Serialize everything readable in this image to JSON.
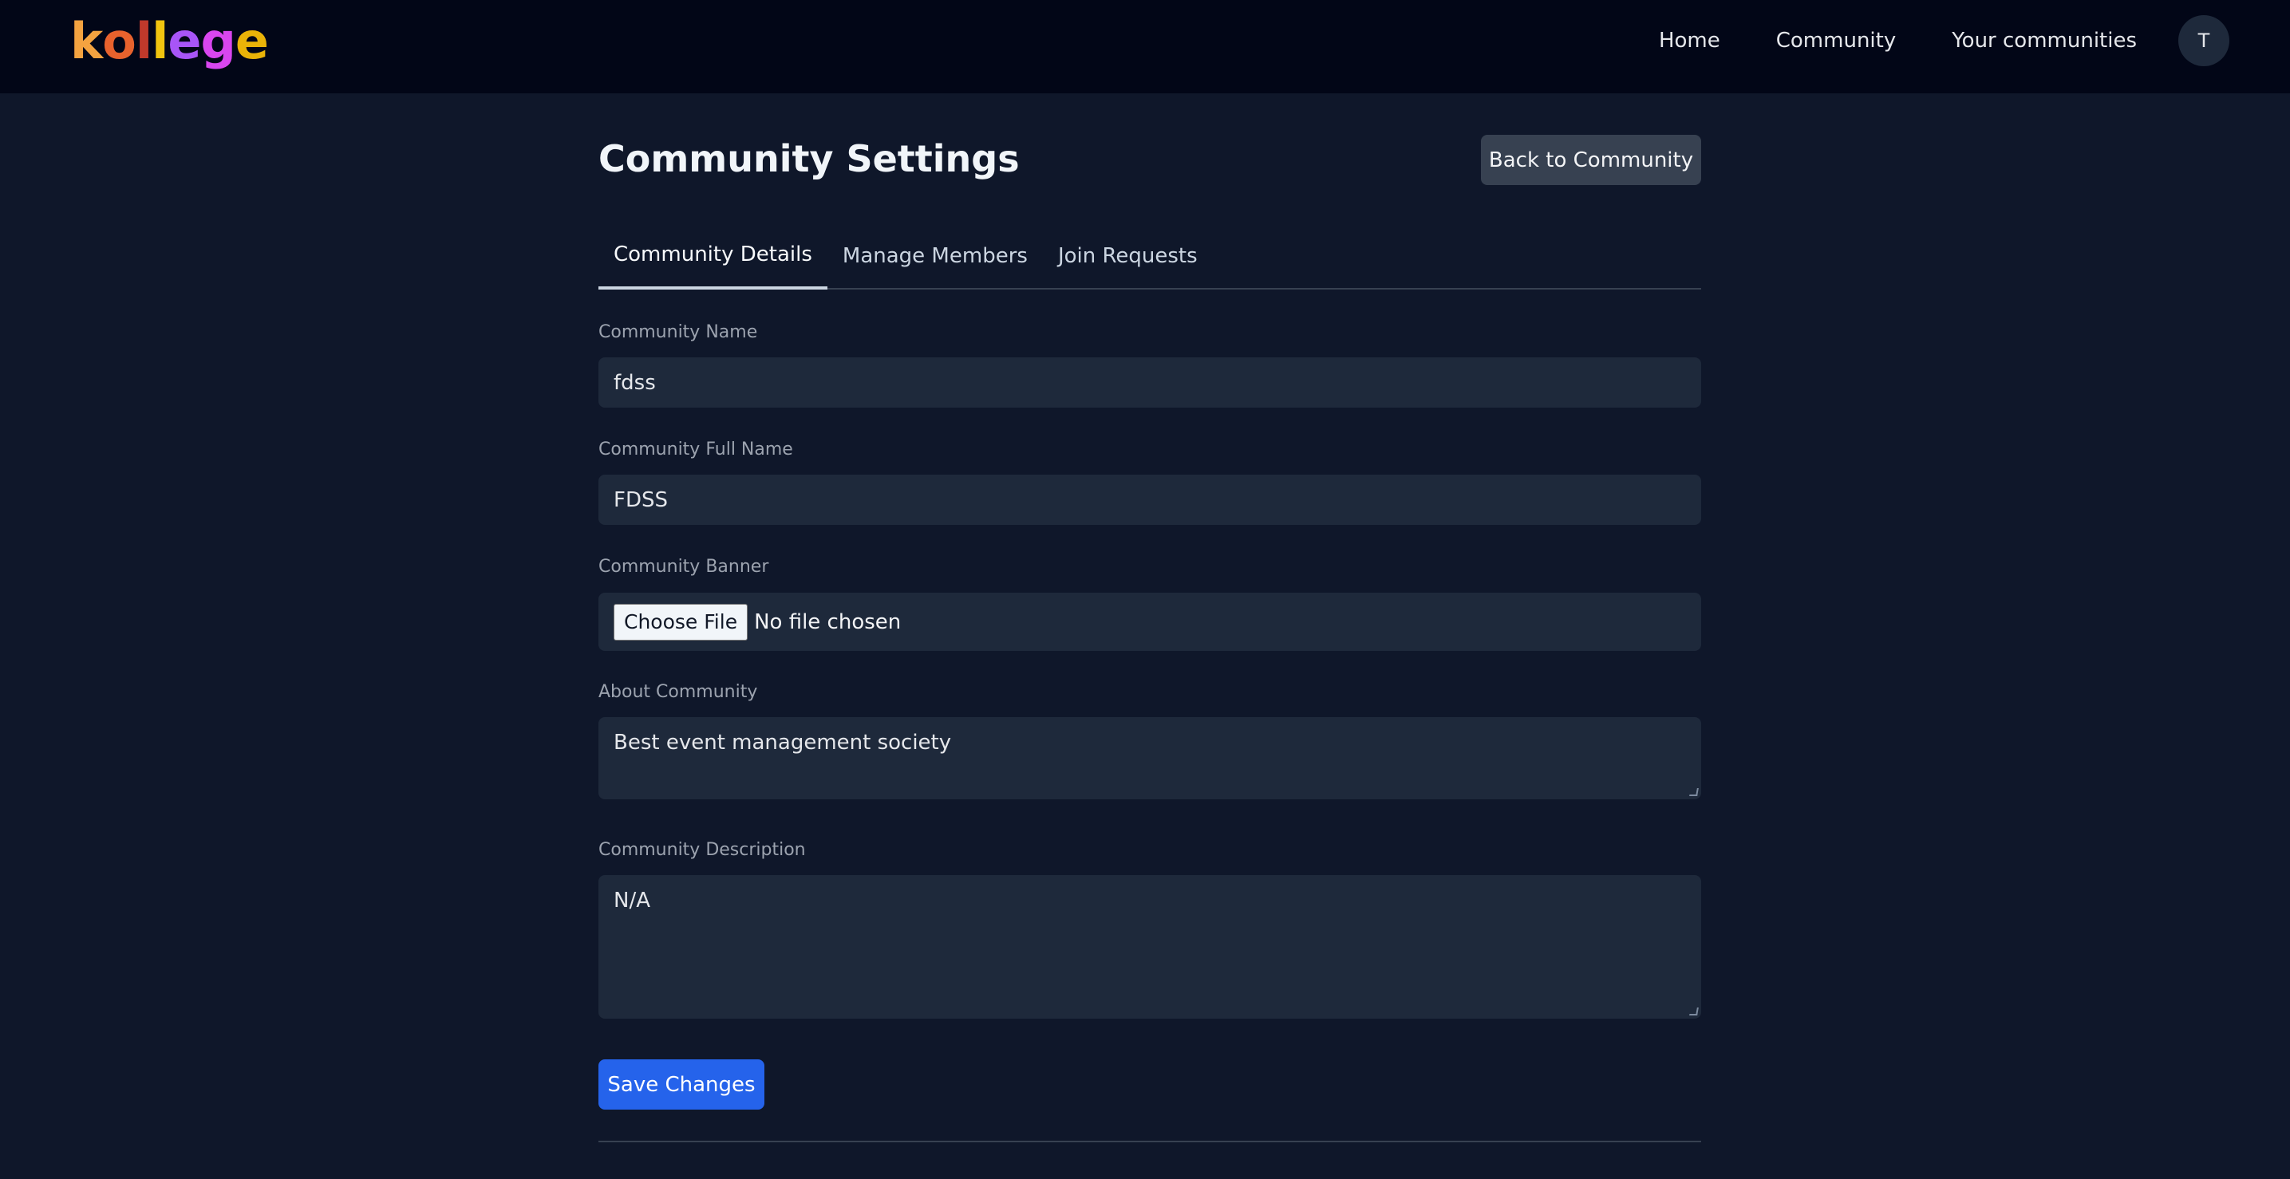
{
  "app": {
    "logo_letters": [
      {
        "char": "k",
        "color": "#f4a340"
      },
      {
        "char": "o",
        "color": "#e8622d"
      },
      {
        "char": "l",
        "color": "#c0392b"
      },
      {
        "char": "l",
        "color": "#f1c40f"
      },
      {
        "char": "e",
        "color": "#a855f7"
      },
      {
        "char": "g",
        "color": "#d946ef"
      },
      {
        "char": "e",
        "color": "#eab308"
      }
    ]
  },
  "nav": {
    "home": "Home",
    "community": "Community",
    "your_communities": "Your communities",
    "avatar_initial": "T"
  },
  "page": {
    "title": "Community Settings",
    "back_button": "Back to Community"
  },
  "tabs": [
    {
      "label": "Community Details",
      "active": true
    },
    {
      "label": "Manage Members",
      "active": false
    },
    {
      "label": "Join Requests",
      "active": false
    }
  ],
  "form": {
    "name_label": "Community Name",
    "name_value": "fdss",
    "full_name_label": "Community Full Name",
    "full_name_value": "FDSS",
    "banner_label": "Community Banner",
    "banner_button": "Choose File",
    "banner_status": "No file chosen",
    "about_label": "About Community",
    "about_value": "Best event management society",
    "description_label": "Community Description",
    "description_value": "N/A",
    "save_button": "Save Changes"
  },
  "colors": {
    "background": "#0f172a",
    "topbar": "#020617",
    "field": "#1e293b",
    "primary": "#2563eb",
    "secondary_button": "#374151"
  }
}
